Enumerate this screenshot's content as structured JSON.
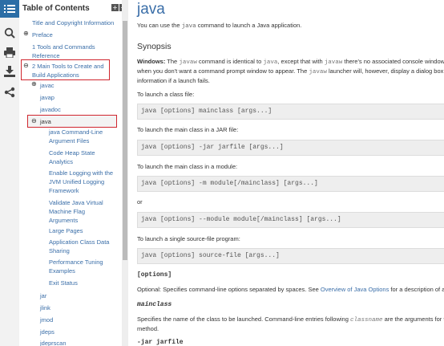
{
  "toc": {
    "title": "Table of Contents",
    "expand_all": "+",
    "collapse_all": "−",
    "items": [
      {
        "label": "Title and Copyright Information"
      },
      {
        "label": "Preface"
      },
      {
        "label": "1 Tools and Commands Reference"
      },
      {
        "label": "2 Main Tools to Create and Build Applications"
      },
      {
        "label": "javac"
      },
      {
        "label": "javap"
      },
      {
        "label": "javadoc"
      },
      {
        "label": "java"
      },
      {
        "label": "java Command-Line Argument Files"
      },
      {
        "label": "Code Heap State Analytics"
      },
      {
        "label": "Enable Logging with the JVM Unified Logging Framework"
      },
      {
        "label": "Validate Java Virtual Machine Flag Arguments"
      },
      {
        "label": "Large Pages"
      },
      {
        "label": "Application Class Data Sharing"
      },
      {
        "label": "Performance Tuning Examples"
      },
      {
        "label": "Exit Status"
      },
      {
        "label": "jar"
      },
      {
        "label": "jlink"
      },
      {
        "label": "jmod"
      },
      {
        "label": "jdeps"
      },
      {
        "label": "jdeprscan"
      }
    ]
  },
  "content": {
    "title": "java",
    "intro_pre": "You can use the ",
    "intro_code": "java",
    "intro_post": " command to launch a Java application.",
    "synopsis_heading": "Synopsis",
    "windows_label": "Windows:",
    "win_1a": " The ",
    "win_1b": "javaw",
    "win_1c": " command is identical to ",
    "win_1d": "java",
    "win_1e": ", except that with ",
    "win_1f": "javaw",
    "win_1g": " there's no associated console window",
    "win_2a": "when you don't want a command prompt window to appear. The ",
    "win_2b": "javaw",
    "win_2c": " launcher will, however, display a dialog box",
    "win_3": "information if a launch fails.",
    "launch_class_label": "To launch a class file:",
    "code_class": "java [options] mainclass [args...]",
    "launch_jar_label": "To launch the main class in a JAR file:",
    "code_jar": "java [options] -jar jarfile [args...]",
    "launch_module_label": "To launch the main class in a module:",
    "code_module": "java [options] -m module[/mainclass] [args...]",
    "or_label": "or",
    "code_module2": "java [options] --module module[/mainclass] [args...]",
    "launch_source_label": "To launch a single source-file program:",
    "code_source": "java [options] source-file [args...]",
    "options_term": "[options]",
    "options_desc_pre": "Optional: Specifies command-line options separated by spaces. See ",
    "options_desc_link": "Overview of Java Options",
    "options_desc_post": " for a description of avail",
    "mainclass_term": "mainclass",
    "mainclass_desc_1a": "Specifies the name of the class to be launched. Command-line entries following ",
    "mainclass_desc_1b": "classname",
    "mainclass_desc_1c": " are the arguments for t",
    "mainclass_desc_2": "method.",
    "jar_term": "-jar jarfile"
  }
}
